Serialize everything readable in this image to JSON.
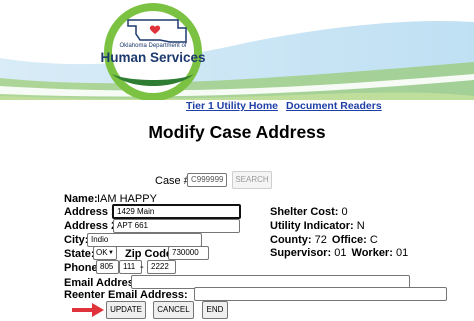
{
  "logo": {
    "org": "Oklahoma Department of",
    "name": "Human Services"
  },
  "nav": {
    "tier1": "Tier 1 Utility Home",
    "readers": "Document Readers"
  },
  "page_title": "Modify Case Address",
  "case": {
    "label": "Case #:",
    "value": "C999999",
    "search_label": "SEARCH"
  },
  "form": {
    "name_label": "Name:",
    "name_value": "IAM  HAPPY",
    "address1_label": "Address 1:",
    "address1_value": "1429 Main",
    "address2_label": "Address 2:",
    "address2_value": "APT 661",
    "city_label": "City:",
    "city_value": "Indio",
    "state_label": "State:",
    "state_value": "OK",
    "zip_label": "Zip Code:",
    "zip_value": "730000",
    "phone_label": "Phone:",
    "phone_area": "805",
    "phone_prefix": "111",
    "phone_sep": "-",
    "phone_line": "2222",
    "email_label": "Email Address:",
    "email_value": "",
    "reenter_label": "Reenter Email Address:",
    "reenter_value": ""
  },
  "info": {
    "shelter_label": "Shelter Cost:",
    "shelter_value": "0",
    "utility_label": "Utility Indicator:",
    "utility_value": "N",
    "county_label": "County:",
    "county_value": "72",
    "office_label": "Office:",
    "office_value": "C",
    "supervisor_label": "Supervisor:",
    "supervisor_value": "01",
    "worker_label": "Worker:",
    "worker_value": "01"
  },
  "buttons": {
    "update": "UPDATE",
    "cancel": "CANCEL",
    "end": "END"
  },
  "colors": {
    "accent_green": "#7cc242",
    "arrow_red": "#e0323a",
    "link_blue": "#1f3fa6",
    "logo_navy": "#1d3a6e"
  },
  "icons": {
    "pointer": "arrow-right-icon",
    "state_select": "chevron-down-icon"
  }
}
